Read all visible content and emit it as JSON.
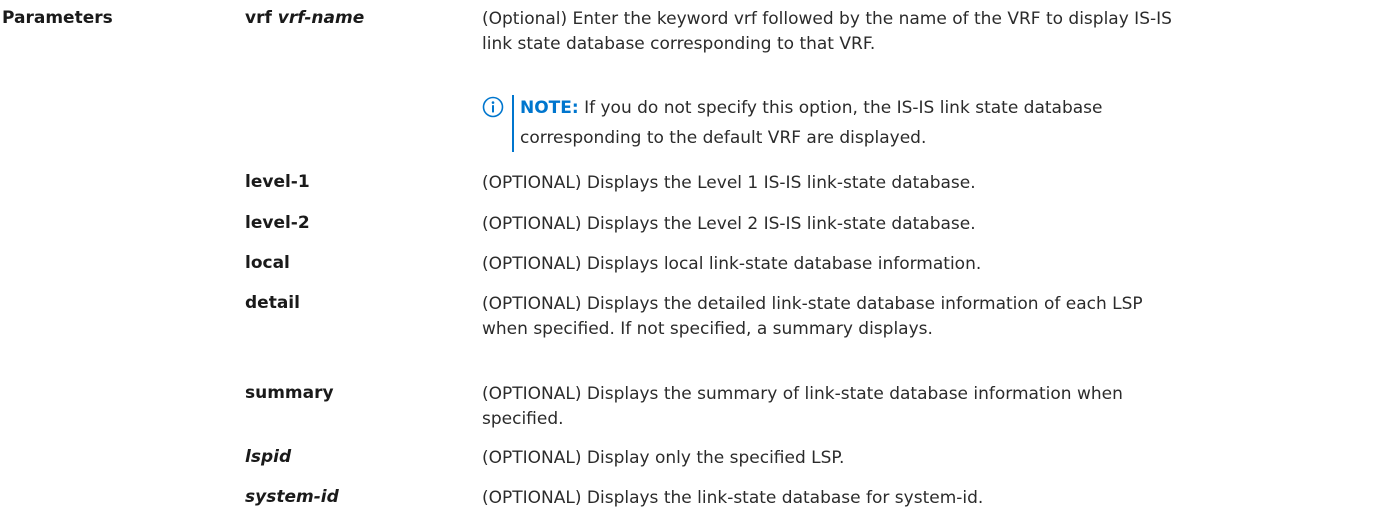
{
  "section_title": "Parameters",
  "params": [
    {
      "term": "vrf",
      "term_arg": "vrf-name",
      "desc": "(Optional) Enter the keyword vrf followed by the name of the VRF to display IS-IS link state database corresponding to that VRF."
    },
    {
      "term": "level-1",
      "desc": "(OPTIONAL) Displays the Level 1 IS-IS link-state database."
    },
    {
      "term": "level-2",
      "desc": "(OPTIONAL) Displays the Level 2 IS-IS link-state database."
    },
    {
      "term": "local",
      "desc": "(OPTIONAL) Displays local link-state database information."
    },
    {
      "term": "detail",
      "desc": "(OPTIONAL) Displays the detailed link-state database information of each LSP when specified. If not specified, a summary displays."
    },
    {
      "term": "summary",
      "desc": "(OPTIONAL) Displays the summary of link-state database information when specified."
    },
    {
      "term_arg": "lspid",
      "desc": "(OPTIONAL) Display only the specified LSP."
    },
    {
      "term_arg": "system-id",
      "desc": "(OPTIONAL) Displays the link-state database for system-id."
    }
  ],
  "note": {
    "icon": "info-icon",
    "label": "NOTE:",
    "text": "If you do not specify this option, the IS-IS link state database corresponding to the default VRF are displayed.",
    "accent_color": "#0076ce"
  }
}
